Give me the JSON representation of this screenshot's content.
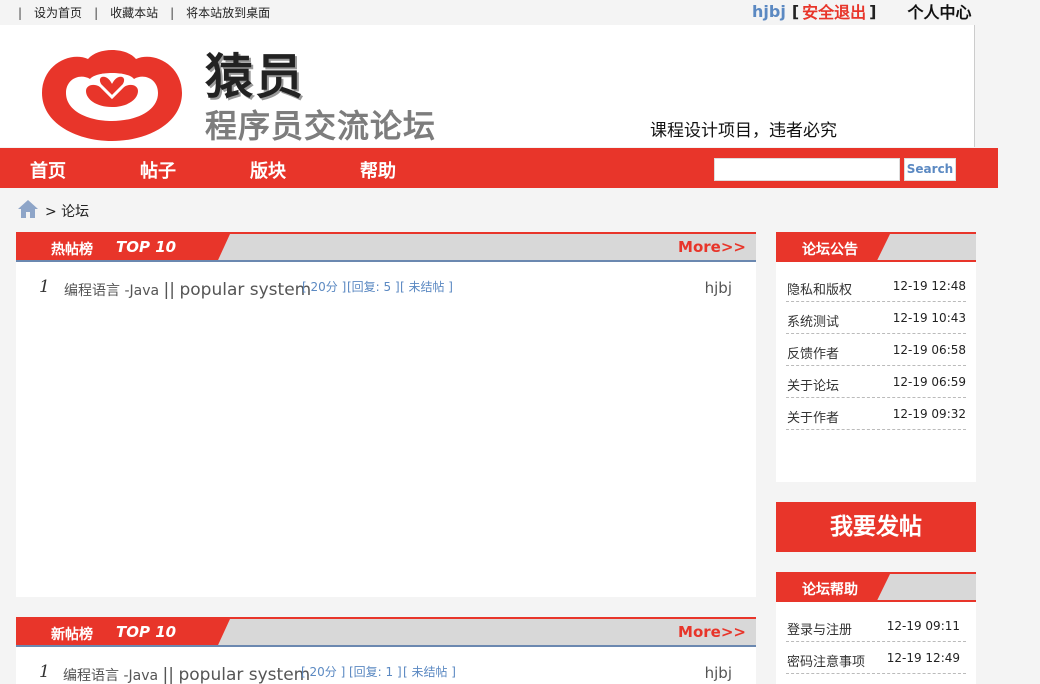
{
  "topbar": {
    "links": [
      "设为首页",
      "收藏本站",
      "将本站放到桌面"
    ],
    "separator": "|",
    "username": "hjbj",
    "bracket_open": "[",
    "logout": "安全退出",
    "bracket_close": "]",
    "user_center": "个人中心"
  },
  "header": {
    "brand_name": "猿员",
    "brand_subtitle": "程序员交流论坛",
    "slogan": "课程设计项目，违者必究"
  },
  "nav": {
    "items": [
      "首页",
      "帖子",
      "版块",
      "帮助"
    ],
    "search_placeholder": "",
    "search_button": "Search"
  },
  "breadcrumb": {
    "text": "> 论坛"
  },
  "hot": {
    "label": "热帖榜",
    "top": "TOP 10",
    "more": "More>>",
    "rows": [
      {
        "num": "1",
        "category": "编程语言",
        "dash": "-",
        "lang": "Java",
        "sep": "||",
        "title": "popular system",
        "score": "[ 20分 ]",
        "replies": "[回复: 5 ]",
        "status": "[ 未结帖 ]",
        "author": "hjbj"
      }
    ]
  },
  "new": {
    "label": "新帖榜",
    "top": "TOP 10",
    "more": "More>>",
    "rows": [
      {
        "num": "1",
        "category": "编程语言",
        "dash": "-",
        "lang": "Java",
        "sep": "||",
        "title": "popular system",
        "score": "[ 20分 ]",
        "replies": "[回复: 1 ]",
        "status": "[ 未结帖 ]",
        "author": "hjbj"
      }
    ]
  },
  "announcements": {
    "title": "论坛公告",
    "items": [
      {
        "label": "隐私和版权",
        "date": "12-19 12:48"
      },
      {
        "label": "系统测试",
        "date": "12-19 10:43"
      },
      {
        "label": "反馈作者",
        "date": "12-19 06:58"
      },
      {
        "label": "关于论坛",
        "date": "12-19 06:59"
      },
      {
        "label": "关于作者",
        "date": "12-19 09:32"
      }
    ]
  },
  "post_button": "我要发帖",
  "help": {
    "title": "论坛帮助",
    "items": [
      {
        "label": "登录与注册",
        "date": "12-19 09:11"
      },
      {
        "label": "密码注意事项",
        "date": "12-19 12:49"
      }
    ]
  },
  "colors": {
    "accent": "#e8352a",
    "link_blue": "#5b89c2",
    "panel_gray": "#d8d8d8"
  }
}
